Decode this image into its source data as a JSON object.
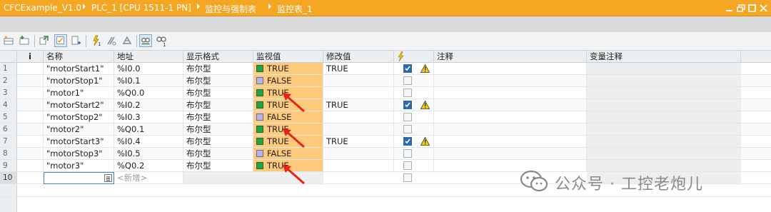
{
  "title": {
    "crumbs": [
      "CFCExample_V1.0",
      "PLC_1 [CPU 1511-1 PN]",
      "监控与强制表",
      "监控表_1"
    ]
  },
  "toolbar": {
    "icons": [
      "add-row-icon",
      "insert-row-icon",
      "update-icon",
      "monitor-all-icon",
      "monitor-once-icon",
      "modify-icon",
      "modify-now-icon",
      "force-icon",
      "show-extended-icon",
      "show-modify-icon"
    ]
  },
  "table": {
    "info_icon": "i",
    "columns": [
      "名称",
      "地址",
      "显示格式",
      "监视值",
      "修改值",
      "注释",
      "变量注释"
    ],
    "rows": [
      {
        "index": "1",
        "name": "\"motorStart1\"",
        "address": "%I0.0",
        "format": "布尔型",
        "value": "TRUE",
        "state": "true",
        "modify": "TRUE",
        "checked": true,
        "warning": true
      },
      {
        "index": "2",
        "name": "\"motorStop1\"",
        "address": "%I0.1",
        "format": "布尔型",
        "value": "FALSE",
        "state": "false",
        "modify": "",
        "checked": false,
        "warning": false
      },
      {
        "index": "3",
        "name": "\"motor1\"",
        "address": "%Q0.0",
        "format": "布尔型",
        "value": "TRUE",
        "state": "true",
        "modify": "",
        "checked": false,
        "warning": false
      },
      {
        "index": "4",
        "name": "\"motorStart2\"",
        "address": "%I0.2",
        "format": "布尔型",
        "value": "TRUE",
        "state": "true",
        "modify": "TRUE",
        "checked": true,
        "warning": true
      },
      {
        "index": "5",
        "name": "\"motorStop2\"",
        "address": "%I0.3",
        "format": "布尔型",
        "value": "FALSE",
        "state": "false",
        "modify": "",
        "checked": false,
        "warning": false
      },
      {
        "index": "6",
        "name": "\"motor2\"",
        "address": "%Q0.1",
        "format": "布尔型",
        "value": "TRUE",
        "state": "true",
        "modify": "",
        "checked": false,
        "warning": false
      },
      {
        "index": "7",
        "name": "\"motorStart3\"",
        "address": "%I0.4",
        "format": "布尔型",
        "value": "TRUE",
        "state": "true",
        "modify": "TRUE",
        "checked": true,
        "warning": true
      },
      {
        "index": "8",
        "name": "\"motorStop3\"",
        "address": "%I0.5",
        "format": "布尔型",
        "value": "FALSE",
        "state": "false",
        "modify": "",
        "checked": false,
        "warning": false
      },
      {
        "index": "9",
        "name": "\"motor3\"",
        "address": "%Q0.2",
        "format": "布尔型",
        "value": "TRUE",
        "state": "true",
        "modify": "",
        "checked": false,
        "warning": false
      }
    ],
    "new_row": {
      "index": "10",
      "placeholder": "<新增>"
    }
  },
  "watermark": {
    "text": "公众号 · 工控老炮儿"
  },
  "colors": {
    "accent": "#f5a623",
    "monitor_bg": "#fdc97a",
    "true_indicator": "#22a34a",
    "false_indicator": "#b8b4e6",
    "arrow": "#e8231b"
  }
}
